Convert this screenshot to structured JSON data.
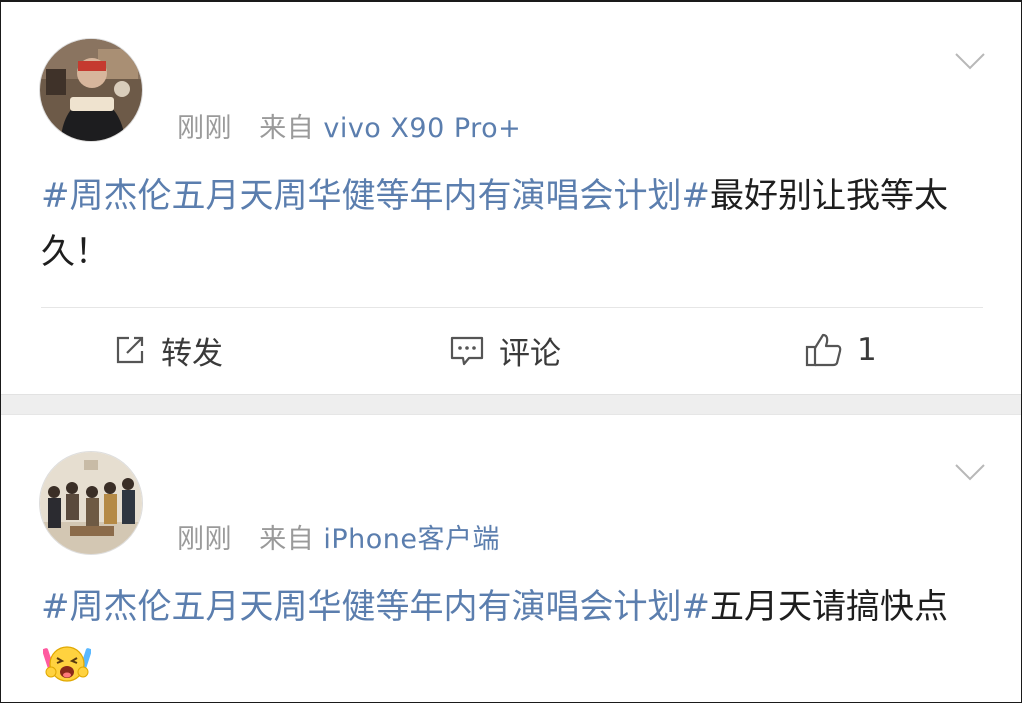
{
  "posts": [
    {
      "time": "刚刚",
      "from_prefix": "来自",
      "source": "vivo X90 Pro+",
      "hashtag": "#周杰伦五月天周华健等年内有演唱会计划#",
      "text": "最好别让我等太久！",
      "actions": {
        "repost_label": "转发",
        "comment_label": "评论",
        "like_count": "1"
      },
      "icons": {
        "avatar": "user-avatar-photo",
        "menu": "chevron-down-icon",
        "repost": "share-edit-icon",
        "comment": "comment-bubble-icon",
        "like": "thumbs-up-icon"
      }
    },
    {
      "time": "刚刚",
      "from_prefix": "来自",
      "source": "iPhone客户端",
      "hashtag": "#周杰伦五月天周华健等年内有演唱会计划#",
      "text": "五月天请搞快点",
      "emoji": "scream-cheer-emoji",
      "icons": {
        "avatar": "group-avatar-photo",
        "menu": "chevron-down-icon"
      }
    }
  ],
  "colors": {
    "link": "#5b7eae",
    "meta": "#9a9a9a",
    "text": "#1e1e1e",
    "band": "#eeeeee"
  }
}
